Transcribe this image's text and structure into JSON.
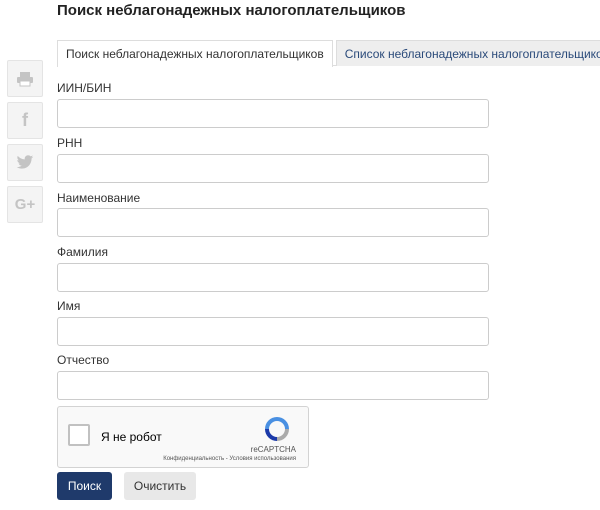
{
  "page": {
    "title": "Поиск неблагонадежных налогоплательщиков"
  },
  "share": [
    {
      "icon": "print-icon"
    },
    {
      "icon": "facebook-icon",
      "glyph": "f"
    },
    {
      "icon": "twitter-icon"
    },
    {
      "icon": "google-plus-icon",
      "glyph": "G+"
    }
  ],
  "tabs": [
    {
      "label": "Поиск неблагонадежных налогоплательщиков",
      "active": true
    },
    {
      "label": "Список неблагонадежных налогоплательщиков",
      "active": false
    }
  ],
  "form": {
    "fields": [
      {
        "label": "ИИН/БИН",
        "value": ""
      },
      {
        "label": "РНН",
        "value": ""
      },
      {
        "label": "Наименование",
        "value": ""
      },
      {
        "label": "Фамилия",
        "value": ""
      },
      {
        "label": "Имя",
        "value": ""
      },
      {
        "label": "Отчество",
        "value": ""
      }
    ]
  },
  "captcha": {
    "label": "Я не робот",
    "brand": "reCAPTCHA",
    "links": "Конфиденциальность - Условия использования"
  },
  "buttons": {
    "search": "Поиск",
    "clear": "Очистить"
  },
  "colors": {
    "primary": "#1f3a6b",
    "tab_link": "#2a4a7a"
  }
}
